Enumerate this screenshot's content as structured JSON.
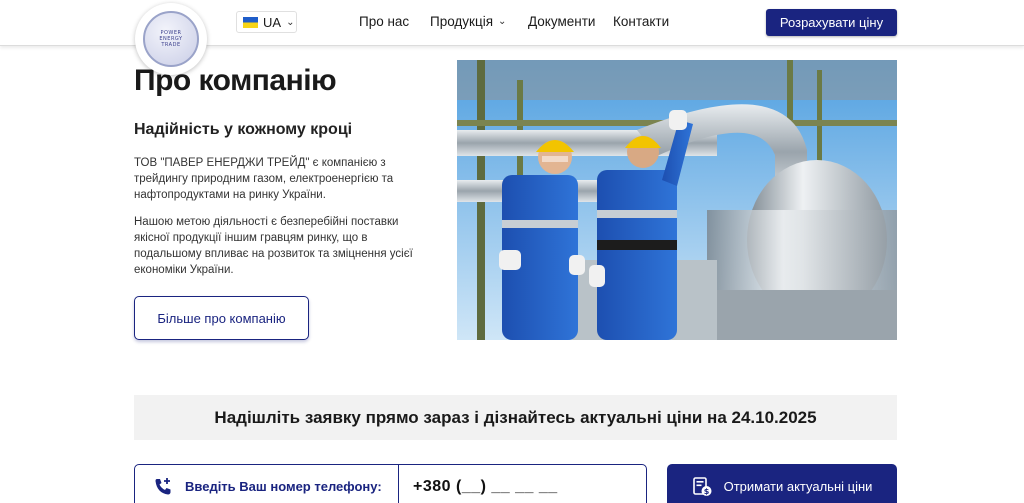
{
  "header": {
    "logo_text": [
      "POWER",
      "ENERGY",
      "TRADE"
    ],
    "language": "UA",
    "nav": {
      "about": "Про нас",
      "products": "Продукція",
      "documents": "Документи",
      "contacts": "Контакти"
    },
    "cta": "Розрахувати ціну"
  },
  "about": {
    "title": "Про компанію",
    "subtitle": "Надійність у кожному кроці",
    "paragraph1": "ТОВ \"ПАВЕР ЕНЕРДЖИ ТРЕЙД\" є компанією з трейдингу природним газом, електроенергією та нафтопродуктами на ринку України.",
    "paragraph2": "Нашою метою діяльності є безперебійні поставки якісної продукції іншим гравцям ринку, що в подальшому впливає на розвиток та зміцнення усієї економіки України.",
    "more_button": "Більше про компанію"
  },
  "banner": {
    "text": "Надішліть заявку прямо зараз і дізнайтесь актуальні ціни на 24.10.2025"
  },
  "form": {
    "phone_label": "Введіть Ваш номер телефону:",
    "phone_value": "+380 (__) __ __ __",
    "submit": "Отримати актуальні ціни"
  },
  "colors": {
    "brand": "#1a2480",
    "banner_bg": "#f2f2f2",
    "flag_blue": "#1f5dc9",
    "flag_yellow": "#f7d417"
  },
  "icons": {
    "phone": "phone-plus-icon",
    "price": "document-money-icon",
    "chevron": "chevron-down-icon"
  }
}
